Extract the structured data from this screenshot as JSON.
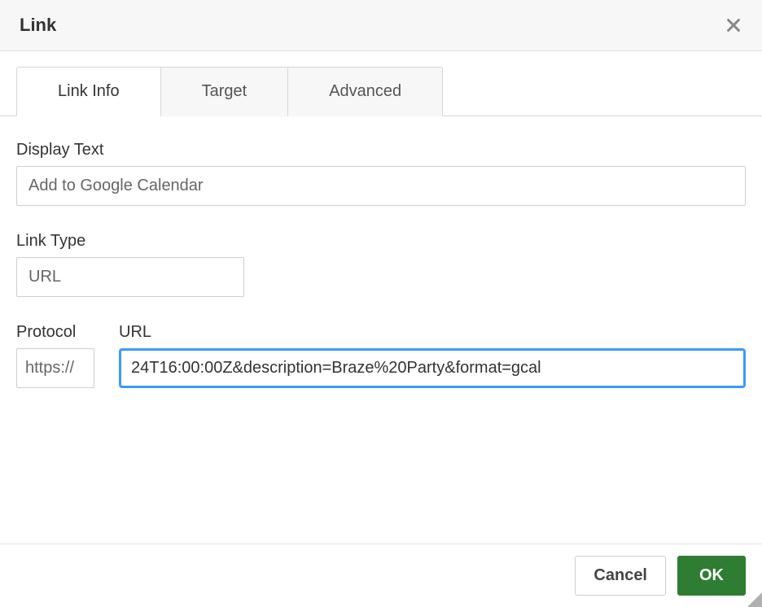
{
  "dialog": {
    "title": "Link"
  },
  "tabs": [
    {
      "label": "Link Info",
      "active": true
    },
    {
      "label": "Target",
      "active": false
    },
    {
      "label": "Advanced",
      "active": false
    }
  ],
  "fields": {
    "displayText": {
      "label": "Display Text",
      "value": "Add to Google Calendar"
    },
    "linkType": {
      "label": "Link Type",
      "value": "URL"
    },
    "protocol": {
      "label": "Protocol",
      "value": "https://"
    },
    "url": {
      "label": "URL",
      "value": "24T16:00:00Z&description=Braze%20Party&format=gcal"
    }
  },
  "footer": {
    "cancel": "Cancel",
    "ok": "OK"
  }
}
